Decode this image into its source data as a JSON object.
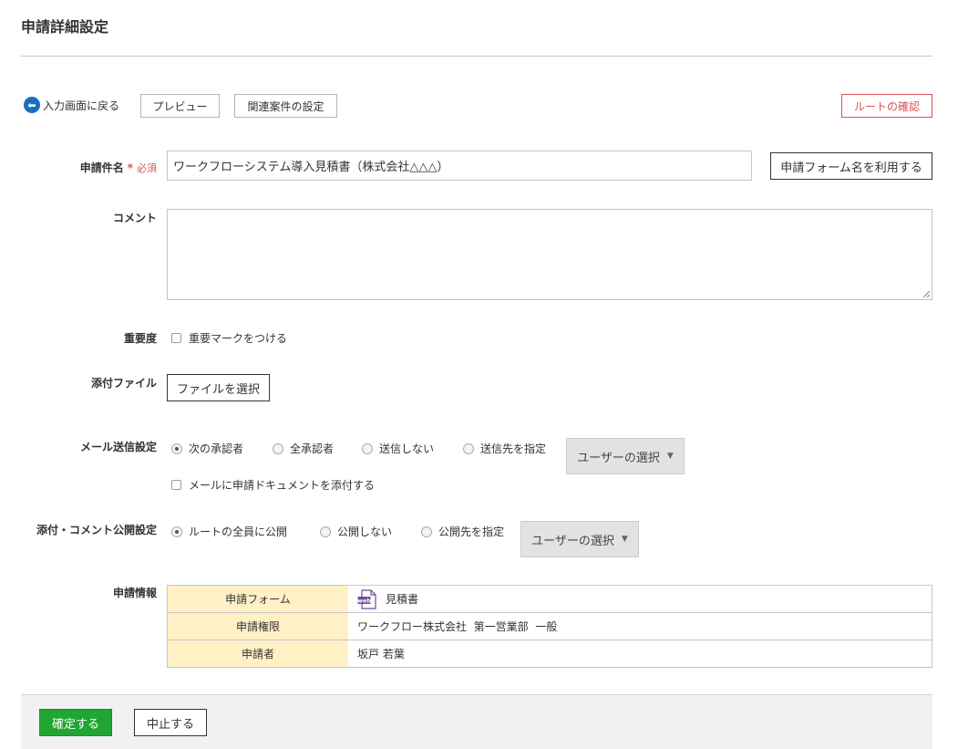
{
  "page": {
    "title": "申請詳細設定"
  },
  "toolbar": {
    "back_label": "入力画面に戻る",
    "preview_label": "プレビュー",
    "related_label": "関連案件の設定",
    "route_label": "ルートの確認"
  },
  "subject": {
    "label": "申請件名",
    "required_star": "*",
    "required_text": "必須",
    "value": "ワークフローシステム導入見積書（株式会社△△△）",
    "use_form_name_label": "申請フォーム名を利用する"
  },
  "comment": {
    "label": "コメント",
    "value": ""
  },
  "priority": {
    "label": "重要度",
    "checkbox_label": "重要マークをつける",
    "checked": false
  },
  "attachment": {
    "label": "添付ファイル",
    "select_label": "ファイルを選択"
  },
  "mail": {
    "label": "メール送信設定",
    "options": [
      "次の承認者",
      "全承認者",
      "送信しない",
      "送信先を指定"
    ],
    "selected": "次の承認者",
    "user_select_label": "ユーザーの選択",
    "attach_doc_label": "メールに申請ドキュメントを添付する",
    "attach_doc_checked": false
  },
  "visibility": {
    "label": "添付・コメント公開設定",
    "options": [
      "ルートの全員に公開",
      "公開しない",
      "公開先を指定"
    ],
    "selected": "ルートの全員に公開",
    "user_select_label": "ユーザーの選択"
  },
  "info": {
    "label": "申請情報",
    "rows": [
      {
        "key": "申請フォーム",
        "value": "見積書",
        "icon": "web-form-icon",
        "icon_text": "web"
      },
      {
        "key": "申請権限",
        "value": "ワークフロー株式会社  第一営業部  一般"
      },
      {
        "key": "申請者",
        "value": "坂戸 若葉"
      }
    ]
  },
  "footer": {
    "confirm_label": "確定する",
    "cancel_label": "中止する"
  },
  "colors": {
    "accent_blue": "#1b6dbf",
    "required_red": "#d9534f",
    "confirm_green": "#21a633",
    "table_head_bg": "#fff0c6",
    "icon_purple": "#6b4a9b"
  }
}
